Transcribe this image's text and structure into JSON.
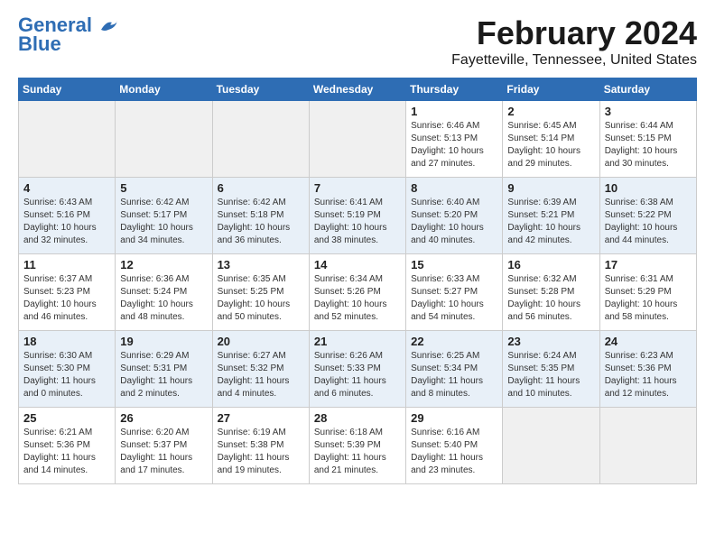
{
  "header": {
    "logo_line1": "General",
    "logo_line2": "Blue",
    "month_title": "February 2024",
    "location": "Fayetteville, Tennessee, United States"
  },
  "weekdays": [
    "Sunday",
    "Monday",
    "Tuesday",
    "Wednesday",
    "Thursday",
    "Friday",
    "Saturday"
  ],
  "weeks": [
    [
      {
        "day": "",
        "info": ""
      },
      {
        "day": "",
        "info": ""
      },
      {
        "day": "",
        "info": ""
      },
      {
        "day": "",
        "info": ""
      },
      {
        "day": "1",
        "info": "Sunrise: 6:46 AM\nSunset: 5:13 PM\nDaylight: 10 hours\nand 27 minutes."
      },
      {
        "day": "2",
        "info": "Sunrise: 6:45 AM\nSunset: 5:14 PM\nDaylight: 10 hours\nand 29 minutes."
      },
      {
        "day": "3",
        "info": "Sunrise: 6:44 AM\nSunset: 5:15 PM\nDaylight: 10 hours\nand 30 minutes."
      }
    ],
    [
      {
        "day": "4",
        "info": "Sunrise: 6:43 AM\nSunset: 5:16 PM\nDaylight: 10 hours\nand 32 minutes."
      },
      {
        "day": "5",
        "info": "Sunrise: 6:42 AM\nSunset: 5:17 PM\nDaylight: 10 hours\nand 34 minutes."
      },
      {
        "day": "6",
        "info": "Sunrise: 6:42 AM\nSunset: 5:18 PM\nDaylight: 10 hours\nand 36 minutes."
      },
      {
        "day": "7",
        "info": "Sunrise: 6:41 AM\nSunset: 5:19 PM\nDaylight: 10 hours\nand 38 minutes."
      },
      {
        "day": "8",
        "info": "Sunrise: 6:40 AM\nSunset: 5:20 PM\nDaylight: 10 hours\nand 40 minutes."
      },
      {
        "day": "9",
        "info": "Sunrise: 6:39 AM\nSunset: 5:21 PM\nDaylight: 10 hours\nand 42 minutes."
      },
      {
        "day": "10",
        "info": "Sunrise: 6:38 AM\nSunset: 5:22 PM\nDaylight: 10 hours\nand 44 minutes."
      }
    ],
    [
      {
        "day": "11",
        "info": "Sunrise: 6:37 AM\nSunset: 5:23 PM\nDaylight: 10 hours\nand 46 minutes."
      },
      {
        "day": "12",
        "info": "Sunrise: 6:36 AM\nSunset: 5:24 PM\nDaylight: 10 hours\nand 48 minutes."
      },
      {
        "day": "13",
        "info": "Sunrise: 6:35 AM\nSunset: 5:25 PM\nDaylight: 10 hours\nand 50 minutes."
      },
      {
        "day": "14",
        "info": "Sunrise: 6:34 AM\nSunset: 5:26 PM\nDaylight: 10 hours\nand 52 minutes."
      },
      {
        "day": "15",
        "info": "Sunrise: 6:33 AM\nSunset: 5:27 PM\nDaylight: 10 hours\nand 54 minutes."
      },
      {
        "day": "16",
        "info": "Sunrise: 6:32 AM\nSunset: 5:28 PM\nDaylight: 10 hours\nand 56 minutes."
      },
      {
        "day": "17",
        "info": "Sunrise: 6:31 AM\nSunset: 5:29 PM\nDaylight: 10 hours\nand 58 minutes."
      }
    ],
    [
      {
        "day": "18",
        "info": "Sunrise: 6:30 AM\nSunset: 5:30 PM\nDaylight: 11 hours\nand 0 minutes."
      },
      {
        "day": "19",
        "info": "Sunrise: 6:29 AM\nSunset: 5:31 PM\nDaylight: 11 hours\nand 2 minutes."
      },
      {
        "day": "20",
        "info": "Sunrise: 6:27 AM\nSunset: 5:32 PM\nDaylight: 11 hours\nand 4 minutes."
      },
      {
        "day": "21",
        "info": "Sunrise: 6:26 AM\nSunset: 5:33 PM\nDaylight: 11 hours\nand 6 minutes."
      },
      {
        "day": "22",
        "info": "Sunrise: 6:25 AM\nSunset: 5:34 PM\nDaylight: 11 hours\nand 8 minutes."
      },
      {
        "day": "23",
        "info": "Sunrise: 6:24 AM\nSunset: 5:35 PM\nDaylight: 11 hours\nand 10 minutes."
      },
      {
        "day": "24",
        "info": "Sunrise: 6:23 AM\nSunset: 5:36 PM\nDaylight: 11 hours\nand 12 minutes."
      }
    ],
    [
      {
        "day": "25",
        "info": "Sunrise: 6:21 AM\nSunset: 5:36 PM\nDaylight: 11 hours\nand 14 minutes."
      },
      {
        "day": "26",
        "info": "Sunrise: 6:20 AM\nSunset: 5:37 PM\nDaylight: 11 hours\nand 17 minutes."
      },
      {
        "day": "27",
        "info": "Sunrise: 6:19 AM\nSunset: 5:38 PM\nDaylight: 11 hours\nand 19 minutes."
      },
      {
        "day": "28",
        "info": "Sunrise: 6:18 AM\nSunset: 5:39 PM\nDaylight: 11 hours\nand 21 minutes."
      },
      {
        "day": "29",
        "info": "Sunrise: 6:16 AM\nSunset: 5:40 PM\nDaylight: 11 hours\nand 23 minutes."
      },
      {
        "day": "",
        "info": ""
      },
      {
        "day": "",
        "info": ""
      }
    ]
  ]
}
